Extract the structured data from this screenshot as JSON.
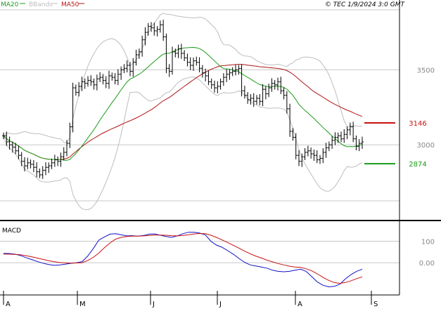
{
  "legend": [
    {
      "name": "MA20",
      "color": "#1a9c1a"
    },
    {
      "name": "BBands",
      "color": "#bdbdbd"
    },
    {
      "name": "MA50",
      "color": "#b01414"
    }
  ],
  "copyright": "© TEC 1/9/2024 3:0 GMT",
  "colors": {
    "price": "#000000",
    "ma20": "#1a9c1a",
    "ma50": "#b01414",
    "bbands": "#bdbdbd",
    "macd": "#1010c8",
    "signal": "#c81010",
    "grid": "#c8c8c8",
    "axis_text": "#888888",
    "panel_border": "#000000"
  },
  "chart_data": [
    {
      "type": "candlestick",
      "x_tick_labels": [
        "A",
        "M",
        "J",
        "J",
        "A",
        "S"
      ],
      "y_tick_labels": [
        "3500",
        "3000"
      ],
      "y_ticks": [
        3500,
        3000
      ],
      "ylim": [
        2500,
        3900
      ],
      "markers": [
        {
          "label": "3146",
          "value": 3146,
          "color": "#c81010"
        },
        {
          "label": "2874",
          "value": 2874,
          "color": "#1a9c1a"
        }
      ],
      "series": {
        "close": [
          3060,
          3020,
          3000,
          2985,
          2960,
          2930,
          2890,
          2860,
          2880,
          2870,
          2850,
          2820,
          2800,
          2830,
          2850,
          2860,
          2880,
          2900,
          2890,
          2920,
          2950,
          3010,
          3120,
          3380,
          3350,
          3390,
          3420,
          3410,
          3430,
          3420,
          3400,
          3440,
          3450,
          3430,
          3410,
          3460,
          3450,
          3430,
          3470,
          3500,
          3510,
          3530,
          3490,
          3550,
          3600,
          3620,
          3700,
          3750,
          3790,
          3780,
          3760,
          3770,
          3800,
          3720,
          3510,
          3490,
          3620,
          3610,
          3640,
          3610,
          3580,
          3550,
          3530,
          3560,
          3550,
          3510,
          3480,
          3460,
          3420,
          3400,
          3380,
          3390,
          3420,
          3450,
          3470,
          3480,
          3490,
          3500,
          3510,
          3360,
          3330,
          3300,
          3310,
          3290,
          3310,
          3290,
          3370,
          3340,
          3380,
          3410,
          3400,
          3420,
          3360,
          3330,
          3240,
          3090,
          3050,
          2930,
          2890,
          2920,
          2950,
          2960,
          2940,
          2930,
          2900,
          2910,
          2950,
          2980,
          3000,
          3030,
          3050,
          3060,
          3040,
          3070,
          3100,
          3120,
          3040,
          2990,
          3010,
          3020
        ]
      }
    },
    {
      "type": "line",
      "title": "MACD",
      "y_tick_labels": [
        "100",
        "0.00"
      ],
      "y_ticks": [
        100,
        0
      ],
      "ylim": [
        -150,
        190
      ],
      "series": [
        {
          "values": [
            44,
            43,
            40,
            34,
            24,
            15,
            6,
            -2,
            -8,
            -12,
            -10,
            -7,
            -3,
            0,
            5,
            30,
            65,
            105,
            120,
            133,
            135,
            130,
            125,
            126,
            124,
            127,
            133,
            134,
            128,
            122,
            118,
            125,
            135,
            142,
            142,
            138,
            130,
            100,
            82,
            72,
            56,
            40,
            20,
            2,
            -10,
            -15,
            -20,
            -25,
            -35,
            -40,
            -42,
            -40,
            -35,
            -30,
            -40,
            -65,
            -90,
            -105,
            -112,
            -110,
            -100,
            -75,
            -55,
            -40,
            -30
          ]
        },
        {
          "values": [
            40,
            40,
            39,
            37,
            33,
            28,
            22,
            16,
            10,
            5,
            1,
            -1,
            -2,
            -1,
            0,
            10,
            25,
            45,
            70,
            92,
            110,
            118,
            122,
            124,
            124,
            125,
            127,
            129,
            129,
            128,
            126,
            125,
            127,
            130,
            134,
            136,
            135,
            128,
            118,
            106,
            94,
            81,
            68,
            54,
            42,
            31,
            22,
            12,
            4,
            -4,
            -10,
            -16,
            -20,
            -22,
            -28,
            -38,
            -52,
            -68,
            -82,
            -92,
            -96,
            -92,
            -84,
            -74,
            -66
          ]
        }
      ]
    }
  ]
}
